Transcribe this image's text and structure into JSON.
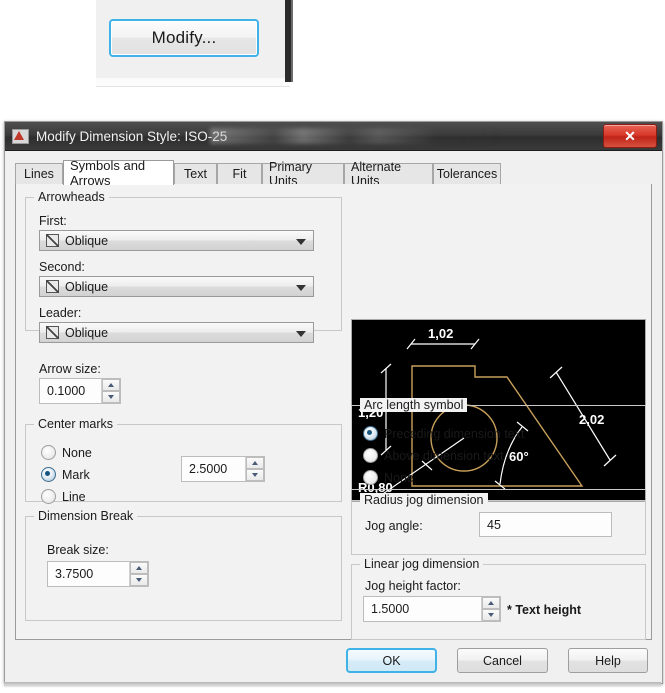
{
  "top_fragment": {
    "modify_button_label": "Modify..."
  },
  "dialog": {
    "title": "Modify Dimension Style: ISO-25",
    "app_icon": "autocad-icon",
    "close_label": "✕",
    "tabs": [
      {
        "label": "Lines",
        "selected": false
      },
      {
        "label": "Symbols and Arrows",
        "selected": true
      },
      {
        "label": "Text",
        "selected": false
      },
      {
        "label": "Fit",
        "selected": false
      },
      {
        "label": "Primary Units",
        "selected": false
      },
      {
        "label": "Alternate Units",
        "selected": false
      },
      {
        "label": "Tolerances",
        "selected": false
      }
    ],
    "arrowheads": {
      "group_label": "Arrowheads",
      "first_label": "First:",
      "first_value": "Oblique",
      "second_label": "Second:",
      "second_value": "Oblique",
      "leader_label": "Leader:",
      "leader_value": "Oblique",
      "arrow_size_label": "Arrow size:",
      "arrow_size_value": "0.1000"
    },
    "center_marks": {
      "group_label": "Center marks",
      "options": [
        {
          "label": "None",
          "selected": false
        },
        {
          "label": "Mark",
          "selected": true
        },
        {
          "label": "Line",
          "selected": false
        }
      ],
      "size_value": "2.5000"
    },
    "dimension_break": {
      "group_label": "Dimension Break",
      "break_size_label": "Break size:",
      "break_size_value": "3.7500"
    },
    "arc_length_symbol": {
      "group_label": "Arc length symbol",
      "options": [
        {
          "label": "Preceding dimension text",
          "selected": true
        },
        {
          "label": "Above dimension text",
          "selected": false
        },
        {
          "label": "None",
          "selected": false
        }
      ]
    },
    "radius_jog": {
      "group_label": "Radius jog dimension",
      "jog_angle_label": "Jog angle:",
      "jog_angle_value": "45"
    },
    "linear_jog": {
      "group_label": "Linear jog dimension",
      "jog_height_label": "Jog height factor:",
      "jog_height_value": "1.5000",
      "suffix": "* Text height"
    },
    "preview": {
      "name": "dimension-style-preview",
      "geometry_color": "#c8a05a",
      "dimension_color": "#ffffff",
      "background": "#000000",
      "labels": {
        "top": "1,02",
        "left": "1,20",
        "right": "2,02",
        "angle": "60°",
        "radius": "R0,80"
      }
    },
    "buttons": {
      "ok": "OK",
      "cancel": "Cancel",
      "help": "Help"
    }
  }
}
